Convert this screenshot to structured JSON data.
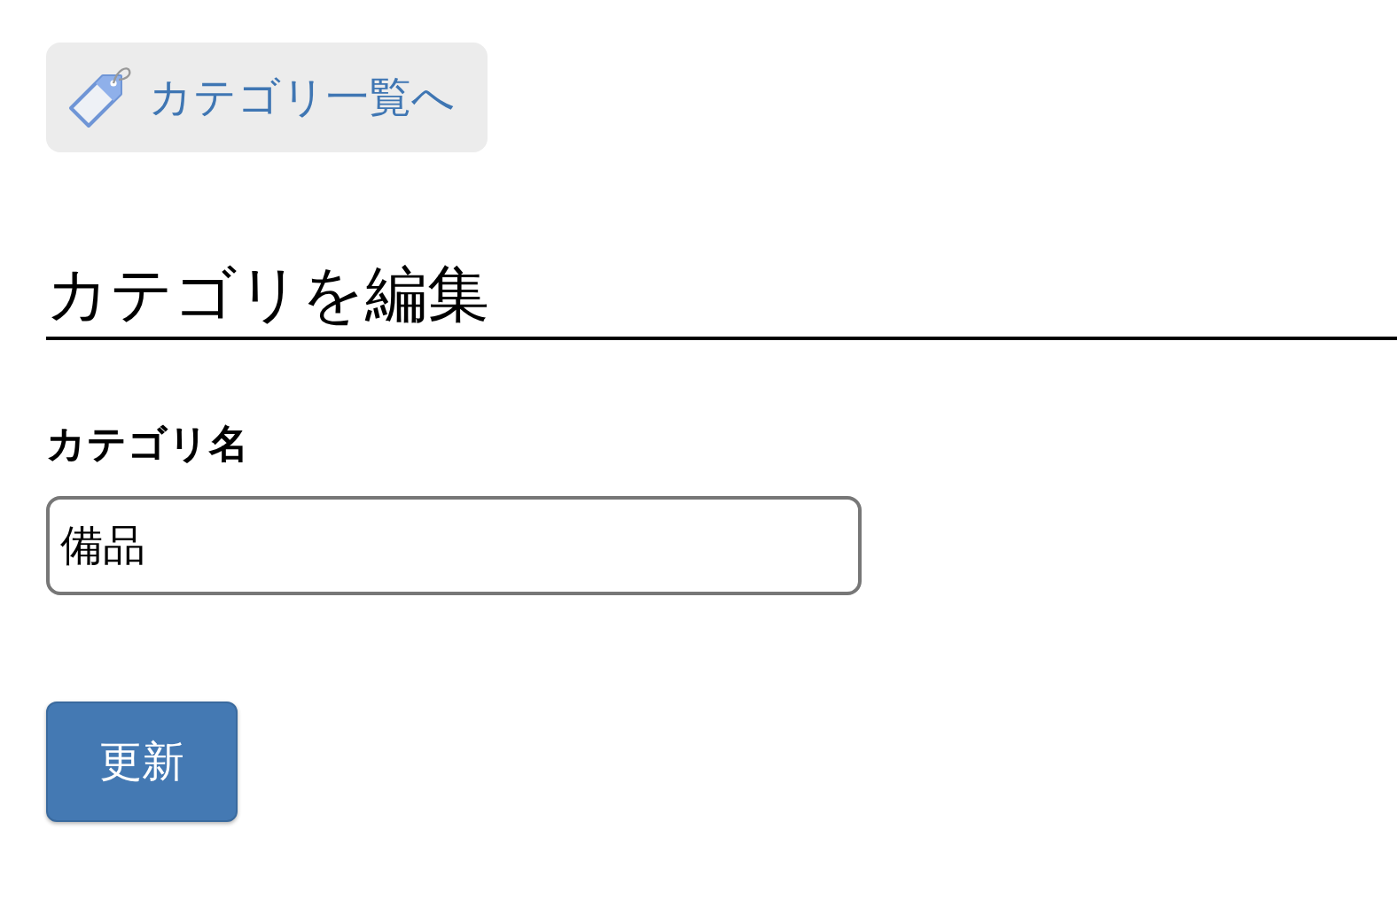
{
  "back_link": {
    "label": "カテゴリ一覧へ"
  },
  "heading": "カテゴリを編集",
  "form": {
    "label": "カテゴリ名",
    "value": "備品"
  },
  "submit_button": "更新"
}
